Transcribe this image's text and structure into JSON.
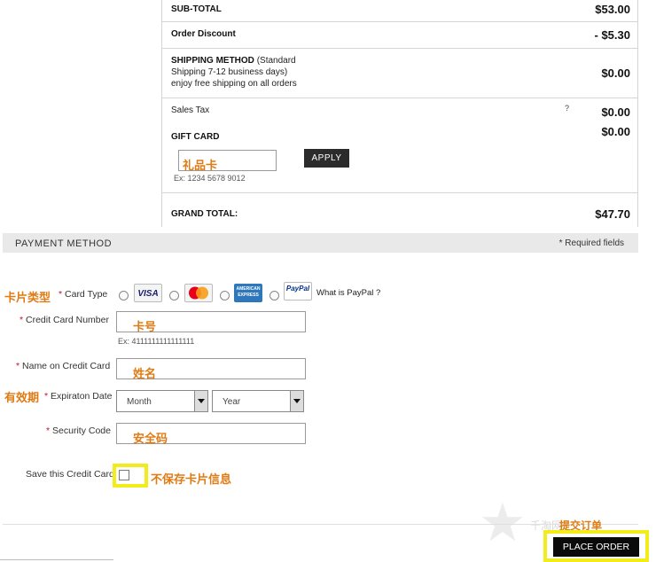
{
  "order_summary": {
    "subtotal_label": "SUB-TOTAL",
    "subtotal_value": "$53.00",
    "discount_label": "Order Discount",
    "discount_value": "- $5.30",
    "shipping_label": "SHIPPING METHOD",
    "shipping_detail_1": "(Standard",
    "shipping_detail_2": "Shipping 7-12 business days)",
    "shipping_detail_3": "enjoy free shipping on all orders",
    "shipping_value": "$0.00",
    "tax_label": "Sales Tax",
    "tax_help": "?",
    "tax_value": "$0.00",
    "giftcard_label": "GIFT CARD",
    "giftcard_value": "$0.00",
    "giftcard_input_annotation": "礼品卡",
    "giftcard_example": "Ex: 1234 5678 9012",
    "apply_label": "APPLY",
    "grand_total_label": "GRAND TOTAL:",
    "grand_total_value": "$47.70"
  },
  "payment": {
    "title": "PAYMENT METHOD",
    "required_note": "* Required fields",
    "card_type_annotation": "卡片类型",
    "card_type_label": "Card Type",
    "cards": [
      "VISA",
      "MasterCard",
      "AMERICAN EXPRESS",
      "PayPal"
    ],
    "paypal_question": "What is PayPal ?",
    "card_number_label": "Credit Card Number",
    "card_number_annotation": "卡号",
    "card_number_example": "Ex: 4111111111111111",
    "name_label": "Name on Credit Card",
    "name_annotation": "姓名",
    "expiry_annotation": "有效期",
    "expiry_label": "Expiraton Date",
    "month_value": "Month",
    "year_value": "Year",
    "security_label": "Security Code",
    "security_annotation": "安全码",
    "save_label": "Save this Credit Card",
    "save_annotation": "不保存卡片信息",
    "required_mark": "*"
  },
  "actions": {
    "place_order_annotation": "提交订单",
    "place_order_label": "PLACE ORDER",
    "watermark": "千淘网"
  },
  "colors": {
    "annotation": "#e07b14",
    "highlight": "#f2ec1a",
    "required": "#c8102e"
  }
}
